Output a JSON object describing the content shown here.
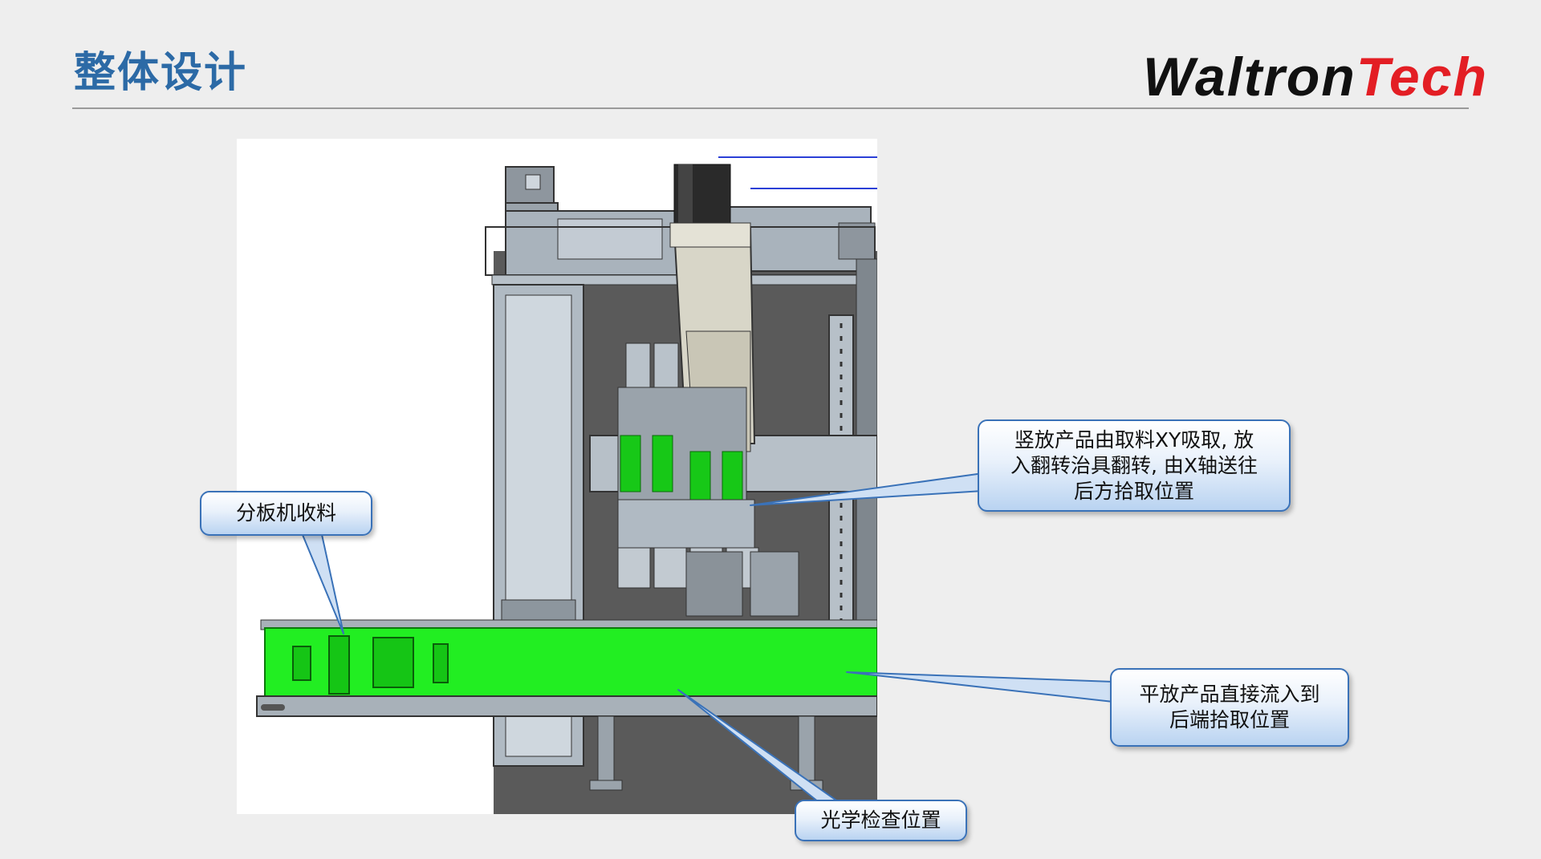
{
  "header": {
    "title": "整体设计",
    "logo_primary": "Waltron",
    "logo_secondary": "Tech"
  },
  "colors": {
    "title": "#2c6aa6",
    "logo_primary": "#111111",
    "logo_secondary": "#e31e24",
    "conveyor_green": "#22ee22",
    "callout_border": "#3a72b8"
  },
  "callouts": {
    "vertical_product": {
      "line1": "竖放产品由取料XY吸取, 放",
      "line2": "入翻转治具翻转, 由X轴送往",
      "line3": "后方拾取位置"
    },
    "board_separator": {
      "line1": "分板机收料"
    },
    "flat_product": {
      "line1": "平放产品直接流入到",
      "line2": "后端拾取位置"
    },
    "optical_inspection": {
      "line1": "光学检查位置"
    }
  }
}
